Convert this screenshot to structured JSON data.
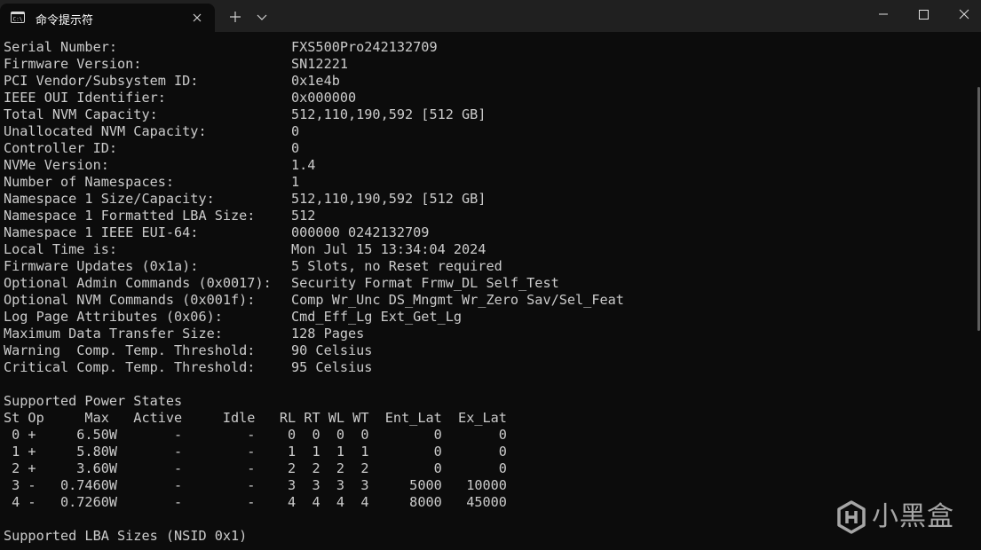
{
  "window": {
    "tab_title": "命令提示符",
    "icons": {
      "tab": "terminal-icon",
      "tab_close": "close-icon",
      "new_tab": "plus-icon",
      "dropdown": "chevron-down-icon",
      "minimize": "minimize-icon",
      "maximize": "maximize-icon",
      "close": "close-icon"
    }
  },
  "colors": {
    "titlebar_bg": "#202020",
    "terminal_bg": "#0c0c0c",
    "terminal_fg": "#cccccc"
  },
  "info": [
    {
      "label": "Serial Number:",
      "value": "FXS500Pro242132709"
    },
    {
      "label": "Firmware Version:",
      "value": "SN12221"
    },
    {
      "label": "PCI Vendor/Subsystem ID:",
      "value": "0x1e4b"
    },
    {
      "label": "IEEE OUI Identifier:",
      "value": "0x000000"
    },
    {
      "label": "Total NVM Capacity:",
      "value": "512,110,190,592 [512 GB]"
    },
    {
      "label": "Unallocated NVM Capacity:",
      "value": "0"
    },
    {
      "label": "Controller ID:",
      "value": "0"
    },
    {
      "label": "NVMe Version:",
      "value": "1.4"
    },
    {
      "label": "Number of Namespaces:",
      "value": "1"
    },
    {
      "label": "Namespace 1 Size/Capacity:",
      "value": "512,110,190,592 [512 GB]"
    },
    {
      "label": "Namespace 1 Formatted LBA Size:",
      "value": "512"
    },
    {
      "label": "Namespace 1 IEEE EUI-64:",
      "value": "000000 0242132709"
    },
    {
      "label": "Local Time is:",
      "value": "Mon Jul 15 13:34:04 2024"
    },
    {
      "label": "Firmware Updates (0x1a):",
      "value": "5 Slots, no Reset required"
    },
    {
      "label": "Optional Admin Commands (0x0017):",
      "value": "Security Format Frmw_DL Self_Test"
    },
    {
      "label": "Optional NVM Commands (0x001f):",
      "value": "Comp Wr_Unc DS_Mngmt Wr_Zero Sav/Sel_Feat"
    },
    {
      "label": "Log Page Attributes (0x06):",
      "value": "Cmd_Eff_Lg Ext_Get_Lg"
    },
    {
      "label": "Maximum Data Transfer Size:",
      "value": "128 Pages"
    },
    {
      "label": "Warning  Comp. Temp. Threshold:",
      "value": "90 Celsius"
    },
    {
      "label": "Critical Comp. Temp. Threshold:",
      "value": "95 Celsius"
    }
  ],
  "power_states": {
    "heading": "Supported Power States",
    "header": "St Op     Max   Active     Idle   RL RT WL WT  Ent_Lat  Ex_Lat",
    "rows": [
      " 0 +     6.50W       -        -    0  0  0  0        0       0",
      " 1 +     5.80W       -        -    1  1  1  1        0       0",
      " 2 +     3.60W       -        -    2  2  2  2        0       0",
      " 3 -   0.7460W       -        -    3  3  3  3     5000   10000",
      " 4 -   0.7260W       -        -    4  4  4  4     8000   45000"
    ]
  },
  "lba_heading": "Supported LBA Sizes (NSID 0x1)",
  "watermark": {
    "text": "小黑盒",
    "icon": "xiaoheihe-logo-icon"
  }
}
